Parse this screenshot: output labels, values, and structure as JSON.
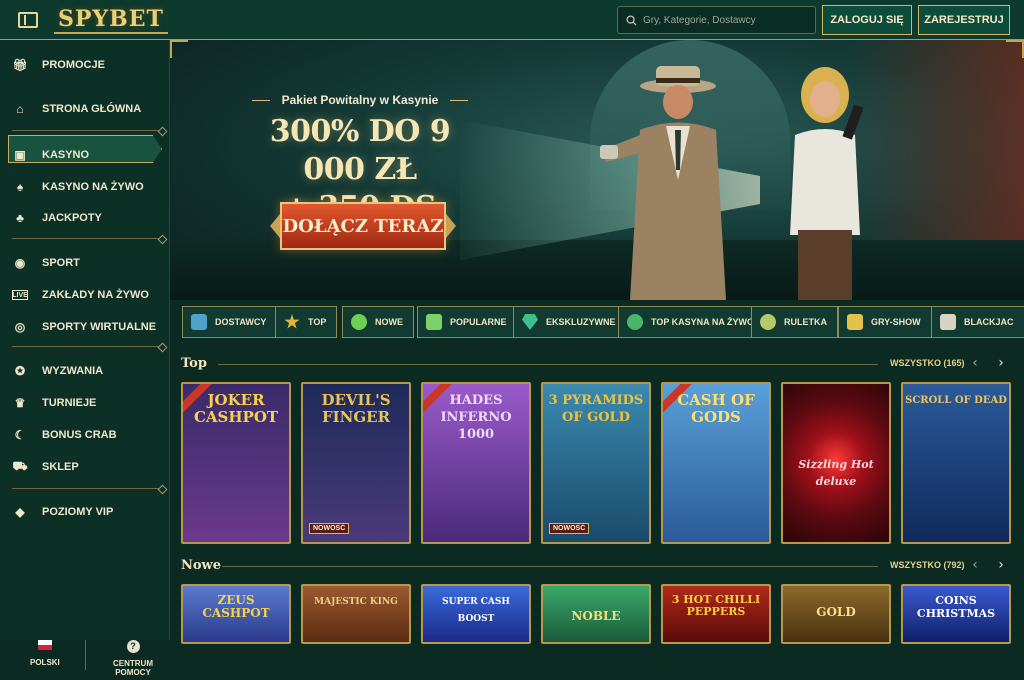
{
  "header": {
    "logo": "SPYBET",
    "search_placeholder": "Gry, Kategorie, Dostawcy",
    "login_label": "ZALOGUJ SIĘ",
    "register_label": "ZAREJESTRUJ"
  },
  "sidebar": {
    "items": [
      {
        "label": "PROMOCJE",
        "icon": "gift-icon"
      },
      {
        "label": "STRONA GŁÓWNA",
        "icon": "home-icon",
        "active": true
      },
      {
        "label": "KASYNO",
        "icon": "slot-machine-icon"
      },
      {
        "label": "KASYNO NA ŻYWO",
        "icon": "cards-icon"
      },
      {
        "label": "JACKPOTY",
        "icon": "clover-icon"
      },
      {
        "label": "SPORT",
        "icon": "ball-icon"
      },
      {
        "label": "ZAKŁADY NA ŻYWO",
        "icon": "live-icon"
      },
      {
        "label": "SPORTY WIRTUALNE",
        "icon": "virtual-icon"
      },
      {
        "label": "WYZWANIA",
        "icon": "medal-icon"
      },
      {
        "label": "TURNIEJE",
        "icon": "trophy-icon"
      },
      {
        "label": "BONUS CRAB",
        "icon": "claw-icon"
      },
      {
        "label": "SKLEP",
        "icon": "cart-icon"
      },
      {
        "label": "POZIOMY VIP",
        "icon": "diamond-icon"
      }
    ],
    "footer": {
      "language": "POLSKI",
      "help": "CENTRUM POMOCY"
    }
  },
  "banner": {
    "subtitle": "Pakiet Powitalny w Kasynie",
    "headline_line1": "300% DO 9 000 ZŁ",
    "headline_line2": "+ 350 DS",
    "cta": "DOŁĄCZ TERAZ"
  },
  "categories": [
    {
      "label": "DOSTAWCY",
      "color": "#4da3c9"
    },
    {
      "label": "TOP",
      "color": "#e2b43a"
    },
    {
      "label": "NOWE",
      "color": "#6fcf55"
    },
    {
      "label": "POPULARNE",
      "color": "#7fd06a"
    },
    {
      "label": "EKSKLUZYWNE",
      "color": "#3fbf8e"
    },
    {
      "label": "TOP KASYNA NA ŻYWO",
      "color": "#4fb36a"
    },
    {
      "label": "RULETKA",
      "color": "#b6c96a"
    },
    {
      "label": "GRY-SHOW",
      "color": "#e3c24c"
    },
    {
      "label": "BLACKJAC",
      "color": "#d9d3c2"
    }
  ],
  "sections": [
    {
      "title": "Top",
      "all_label": "WSZYSTKO (165)",
      "games": [
        {
          "name": "JOKER\nCASHPOT",
          "bg": "#5a2a7a",
          "fg": "#f6d34a",
          "badge": ""
        },
        {
          "name": "DEVIL'S\nFINGER",
          "bg": "#27306a",
          "fg": "#e8c35a",
          "badge": "NOWOŚĆ"
        },
        {
          "name": "HADES\nINFERNO\n1000",
          "bg": "#6a3a9a",
          "fg": "#f3d9ff",
          "badge": ""
        },
        {
          "name": "3 PYRAMIDS\nOF GOLD",
          "bg": "#2a6a8a",
          "fg": "#f2c23a",
          "badge": "NOWOŚĆ"
        },
        {
          "name": "CASH OF\nGODS",
          "bg": "#3a7ab0",
          "fg": "#ffe06a",
          "badge": ""
        },
        {
          "name": "Sizzling Hot deluxe",
          "bg": "#7a0f18",
          "fg": "#ffd6d6",
          "badge": ""
        },
        {
          "name": "SCROLL OF DEAD",
          "bg": "#1a3a6a",
          "fg": "#f0c45a",
          "badge": ""
        }
      ]
    },
    {
      "title": "Nowe",
      "all_label": "WSZYSTKO (792)",
      "games": [
        {
          "name": "ZEUS\nCASHPOT",
          "bg": "#3a5aa0",
          "fg": "#f6d34a"
        },
        {
          "name": "MAJESTIC KING",
          "bg": "#7a3a20",
          "fg": "#f2d07a"
        },
        {
          "name": "SUPER CASH BOOST",
          "bg": "#2a50b0",
          "fg": "#ffffff"
        },
        {
          "name": "NOBLE",
          "bg": "#2a8a5a",
          "fg": "#f6e07a"
        },
        {
          "name": "3 HOT CHILLI PEPPERS",
          "bg": "#8a1a1a",
          "fg": "#ffd040"
        },
        {
          "name": "GOLD",
          "bg": "#6a4a1a",
          "fg": "#ffe08a"
        },
        {
          "name": "COINS CHRISTMAS",
          "bg": "#1a3a8a",
          "fg": "#ffffff"
        }
      ]
    }
  ]
}
